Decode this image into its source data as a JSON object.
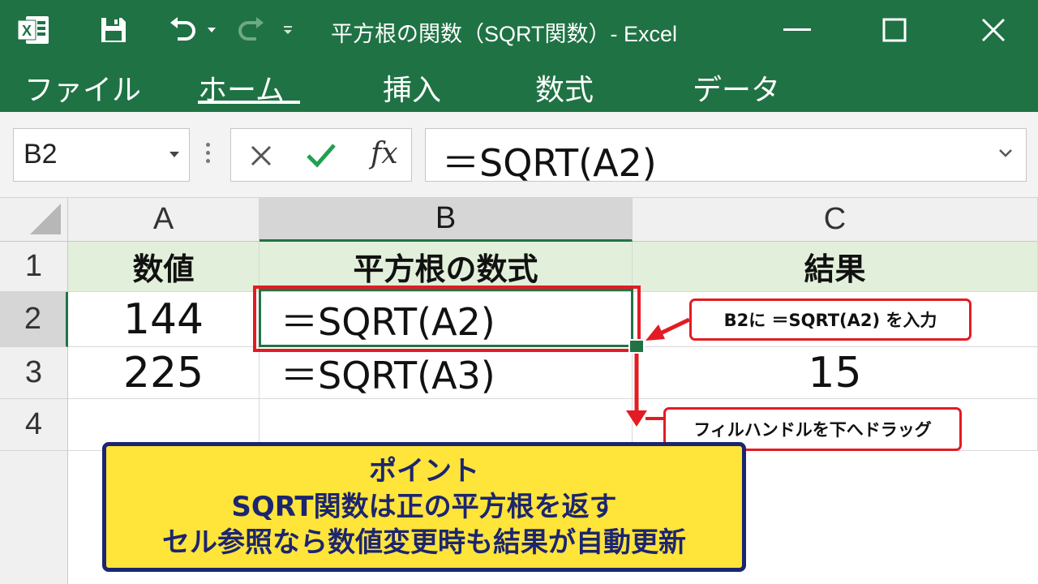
{
  "window": {
    "title": "平方根の関数（SQRT関数）- Excel",
    "app_icon": "excel-logo-icon",
    "title_icons": [
      "save-icon",
      "undo-icon",
      "redo-icon",
      "customize-qat-icon"
    ]
  },
  "ribbon": {
    "tabs": [
      {
        "label": "ファイル"
      },
      {
        "label": "ホーム",
        "active": true
      },
      {
        "label": "挿入"
      },
      {
        "label": "数式"
      },
      {
        "label": "データ"
      }
    ]
  },
  "formula_bar": {
    "name_box": "B2",
    "fx_label": "fx",
    "formula": "＝SQRT(A2)"
  },
  "sheet": {
    "columns": [
      "A",
      "B",
      "C"
    ],
    "rows": [
      "1",
      "2",
      "3",
      "4"
    ],
    "selected_cell": "B2",
    "header_row": {
      "a": "数値",
      "b": "平方根の数式",
      "c": "結果"
    },
    "row2": {
      "a": "144",
      "b": "＝SQRT(A2)",
      "c": ""
    },
    "row3": {
      "a": "225",
      "b": "＝SQRT(A3)",
      "c": "15"
    },
    "row4": {
      "a": "",
      "b": "",
      "c": ""
    }
  },
  "annotations": {
    "callout_input": "B2に ＝SQRT(A2) を入力",
    "callout_drag": "フィルハンドルを下へドラッグ",
    "point": {
      "title": "ポイント",
      "line1": "SQRT関数は正の平方根を返す",
      "line2": "セル参照なら数値変更時も結果が自動更新"
    }
  },
  "colors": {
    "excel_green": "#1f7244",
    "header_row_fill": "#e2efda",
    "callout_red": "#e31b23",
    "point_fill": "#ffe43a",
    "point_border": "#1c2570"
  }
}
